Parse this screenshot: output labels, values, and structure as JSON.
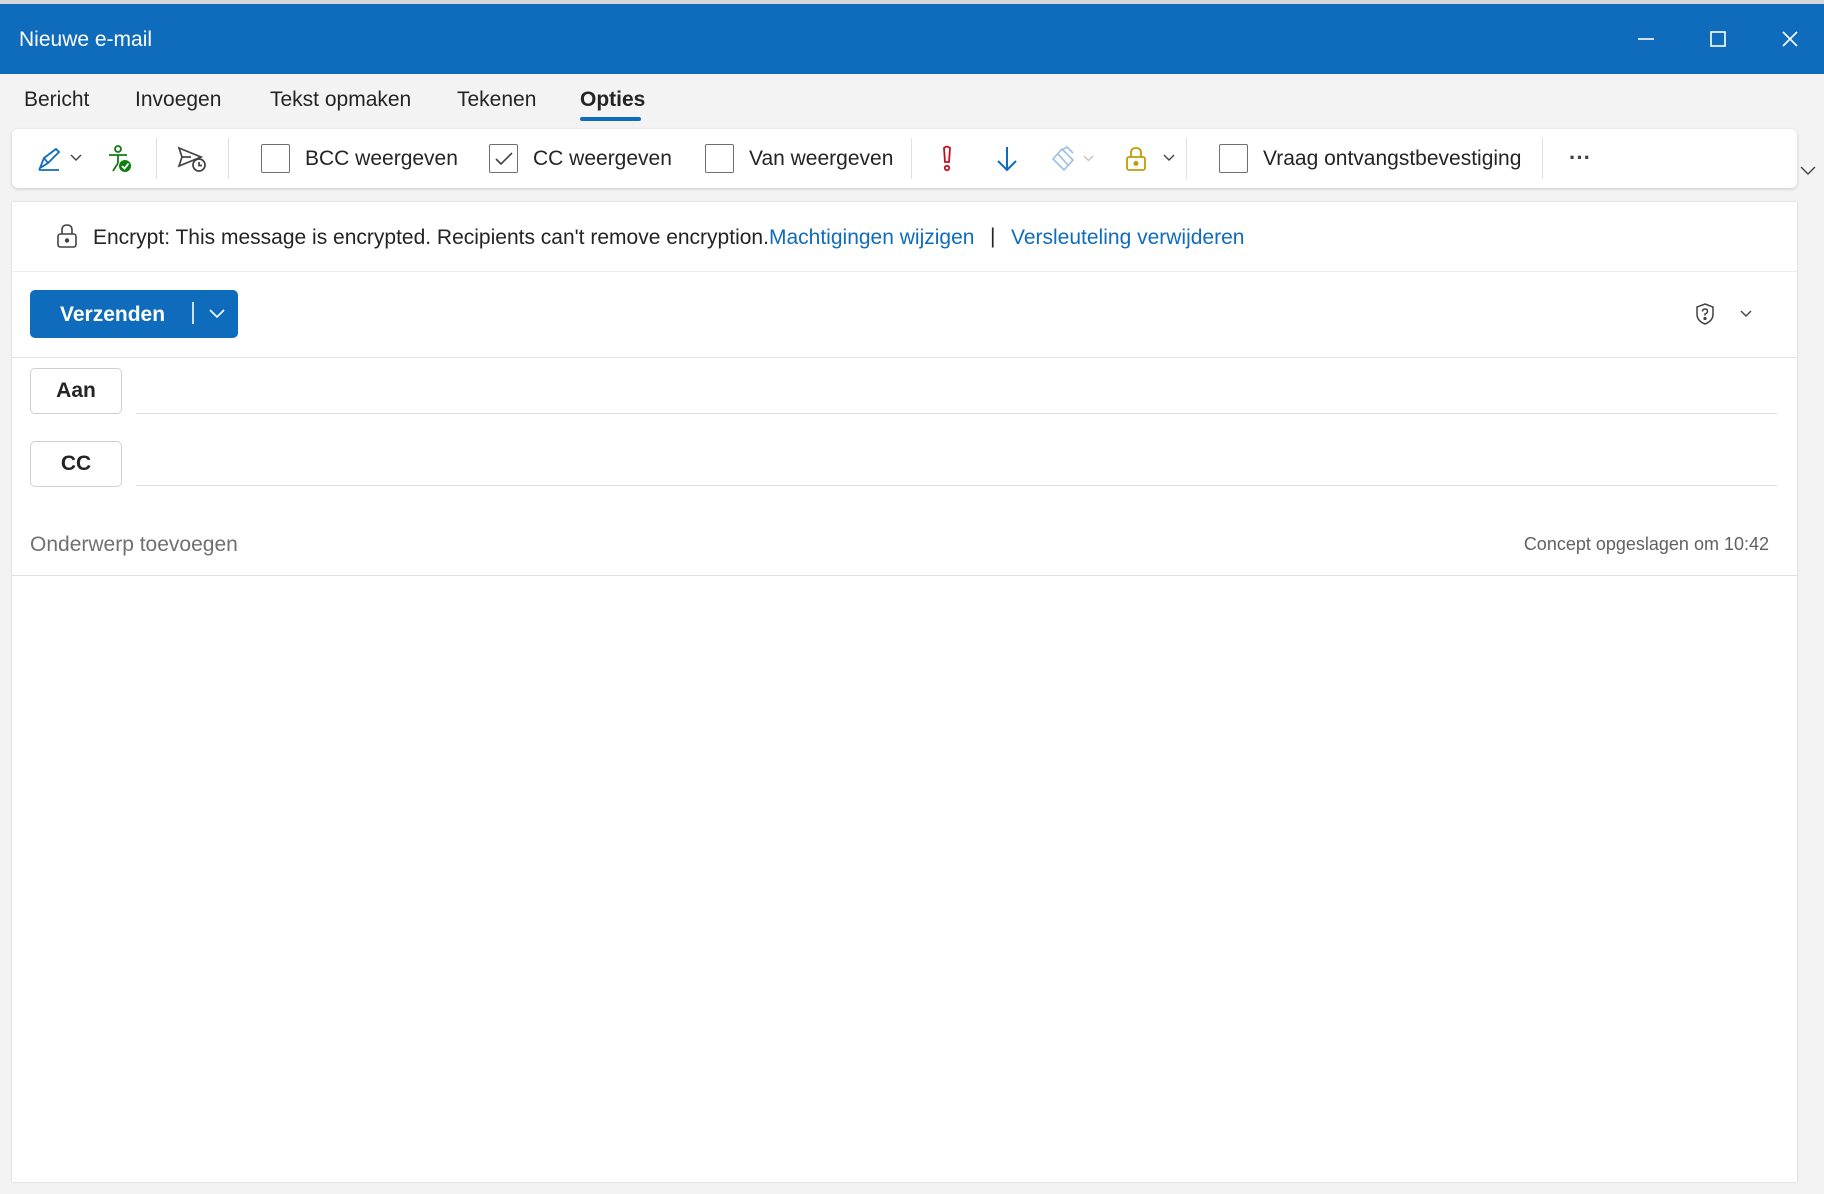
{
  "window": {
    "title": "Nieuwe e-mail",
    "controls": [
      "minimize-icon",
      "maximize-icon",
      "close-icon"
    ]
  },
  "tabs": [
    {
      "label": "Bericht",
      "active": false
    },
    {
      "label": "Invoegen",
      "active": false
    },
    {
      "label": "Tekst opmaken",
      "active": false
    },
    {
      "label": "Tekenen",
      "active": false
    },
    {
      "label": "Opties",
      "active": true
    }
  ],
  "ribbon": {
    "signature_icon": "signature-pen-icon",
    "accessibility_icon": "accessibility-checker-icon",
    "delay_icon": "delay-delivery-icon",
    "checkboxes": [
      {
        "label": "BCC weergeven",
        "checked": false
      },
      {
        "label": "CC weergeven",
        "checked": true
      },
      {
        "label": "Van weergeven",
        "checked": false
      }
    ],
    "importance_high_icon": "importance-high-icon",
    "importance_low_icon": "importance-low-icon",
    "sensitivity_icon": "sensitivity-icon",
    "encrypt_icon": "encrypt-lock-icon",
    "read_receipt": {
      "label": "Vraag ontvangstbevestiging",
      "checked": false
    },
    "more_label": "···"
  },
  "encryption": {
    "message": "Encrypt: This message is encrypted. Recipients can't remove encryption.",
    "change_permissions": "Machtigingen wijzigen",
    "separator": "|",
    "remove_encryption": "Versleuteling verwijderen"
  },
  "compose": {
    "send_label": "Verzenden",
    "to_label": "Aan",
    "cc_label": "CC",
    "subject_placeholder": "Onderwerp toevoegen",
    "draft_status": "Concept opgeslagen om 10:42"
  },
  "colors": {
    "accent": "#0f6cbd",
    "importance_high": "#c50f1f",
    "encrypt_lock": "#c19c00",
    "accessibility_check": "#107c10"
  }
}
